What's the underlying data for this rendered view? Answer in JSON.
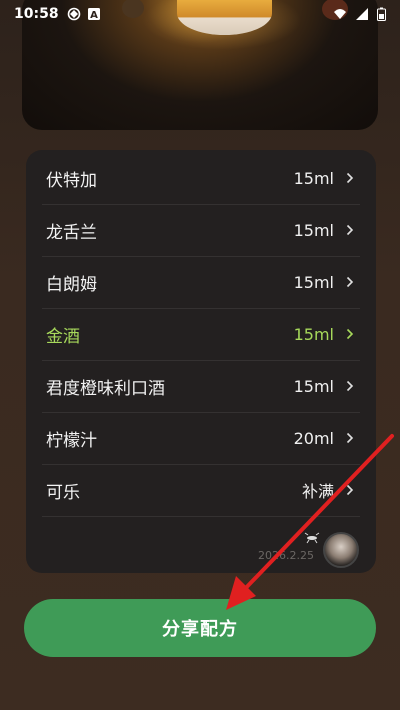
{
  "status_bar": {
    "time": "10:58",
    "left_icons": [
      "sync-icon",
      "text-a-icon"
    ],
    "right_icons": [
      "wifi-icon",
      "signal-icon",
      "battery-icon"
    ]
  },
  "ingredients": [
    {
      "name": "伏特加",
      "amount": "15ml",
      "highlighted": false
    },
    {
      "name": "龙舌兰",
      "amount": "15ml",
      "highlighted": false
    },
    {
      "name": "白朗姆",
      "amount": "15ml",
      "highlighted": false
    },
    {
      "name": "金酒",
      "amount": "15ml",
      "highlighted": true
    },
    {
      "name": "君度橙味利口酒",
      "amount": "15ml",
      "highlighted": false
    },
    {
      "name": "柠檬汁",
      "amount": "20ml",
      "highlighted": false
    },
    {
      "name": "可乐",
      "amount": "补满",
      "highlighted": false
    }
  ],
  "footer": {
    "date": "2026.2.25"
  },
  "share_button": {
    "label": "分享配方"
  },
  "colors": {
    "accent_green": "#3f9b57",
    "highlight_text": "#a7d95b",
    "card_bg": "#232020",
    "arrow_red": "#e02020"
  }
}
